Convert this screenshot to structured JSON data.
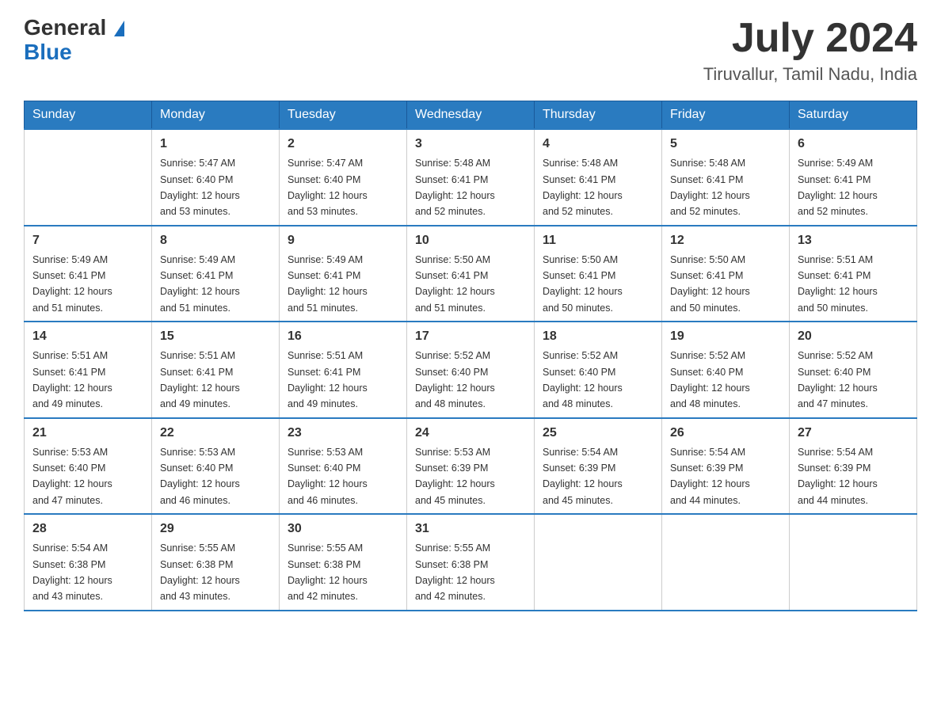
{
  "header": {
    "logo_general": "General",
    "logo_blue": "Blue",
    "month_year": "July 2024",
    "location": "Tiruvallur, Tamil Nadu, India"
  },
  "days_of_week": [
    "Sunday",
    "Monday",
    "Tuesday",
    "Wednesday",
    "Thursday",
    "Friday",
    "Saturday"
  ],
  "weeks": [
    [
      {
        "day": "",
        "info": ""
      },
      {
        "day": "1",
        "info": "Sunrise: 5:47 AM\nSunset: 6:40 PM\nDaylight: 12 hours\nand 53 minutes."
      },
      {
        "day": "2",
        "info": "Sunrise: 5:47 AM\nSunset: 6:40 PM\nDaylight: 12 hours\nand 53 minutes."
      },
      {
        "day": "3",
        "info": "Sunrise: 5:48 AM\nSunset: 6:41 PM\nDaylight: 12 hours\nand 52 minutes."
      },
      {
        "day": "4",
        "info": "Sunrise: 5:48 AM\nSunset: 6:41 PM\nDaylight: 12 hours\nand 52 minutes."
      },
      {
        "day": "5",
        "info": "Sunrise: 5:48 AM\nSunset: 6:41 PM\nDaylight: 12 hours\nand 52 minutes."
      },
      {
        "day": "6",
        "info": "Sunrise: 5:49 AM\nSunset: 6:41 PM\nDaylight: 12 hours\nand 52 minutes."
      }
    ],
    [
      {
        "day": "7",
        "info": "Sunrise: 5:49 AM\nSunset: 6:41 PM\nDaylight: 12 hours\nand 51 minutes."
      },
      {
        "day": "8",
        "info": "Sunrise: 5:49 AM\nSunset: 6:41 PM\nDaylight: 12 hours\nand 51 minutes."
      },
      {
        "day": "9",
        "info": "Sunrise: 5:49 AM\nSunset: 6:41 PM\nDaylight: 12 hours\nand 51 minutes."
      },
      {
        "day": "10",
        "info": "Sunrise: 5:50 AM\nSunset: 6:41 PM\nDaylight: 12 hours\nand 51 minutes."
      },
      {
        "day": "11",
        "info": "Sunrise: 5:50 AM\nSunset: 6:41 PM\nDaylight: 12 hours\nand 50 minutes."
      },
      {
        "day": "12",
        "info": "Sunrise: 5:50 AM\nSunset: 6:41 PM\nDaylight: 12 hours\nand 50 minutes."
      },
      {
        "day": "13",
        "info": "Sunrise: 5:51 AM\nSunset: 6:41 PM\nDaylight: 12 hours\nand 50 minutes."
      }
    ],
    [
      {
        "day": "14",
        "info": "Sunrise: 5:51 AM\nSunset: 6:41 PM\nDaylight: 12 hours\nand 49 minutes."
      },
      {
        "day": "15",
        "info": "Sunrise: 5:51 AM\nSunset: 6:41 PM\nDaylight: 12 hours\nand 49 minutes."
      },
      {
        "day": "16",
        "info": "Sunrise: 5:51 AM\nSunset: 6:41 PM\nDaylight: 12 hours\nand 49 minutes."
      },
      {
        "day": "17",
        "info": "Sunrise: 5:52 AM\nSunset: 6:40 PM\nDaylight: 12 hours\nand 48 minutes."
      },
      {
        "day": "18",
        "info": "Sunrise: 5:52 AM\nSunset: 6:40 PM\nDaylight: 12 hours\nand 48 minutes."
      },
      {
        "day": "19",
        "info": "Sunrise: 5:52 AM\nSunset: 6:40 PM\nDaylight: 12 hours\nand 48 minutes."
      },
      {
        "day": "20",
        "info": "Sunrise: 5:52 AM\nSunset: 6:40 PM\nDaylight: 12 hours\nand 47 minutes."
      }
    ],
    [
      {
        "day": "21",
        "info": "Sunrise: 5:53 AM\nSunset: 6:40 PM\nDaylight: 12 hours\nand 47 minutes."
      },
      {
        "day": "22",
        "info": "Sunrise: 5:53 AM\nSunset: 6:40 PM\nDaylight: 12 hours\nand 46 minutes."
      },
      {
        "day": "23",
        "info": "Sunrise: 5:53 AM\nSunset: 6:40 PM\nDaylight: 12 hours\nand 46 minutes."
      },
      {
        "day": "24",
        "info": "Sunrise: 5:53 AM\nSunset: 6:39 PM\nDaylight: 12 hours\nand 45 minutes."
      },
      {
        "day": "25",
        "info": "Sunrise: 5:54 AM\nSunset: 6:39 PM\nDaylight: 12 hours\nand 45 minutes."
      },
      {
        "day": "26",
        "info": "Sunrise: 5:54 AM\nSunset: 6:39 PM\nDaylight: 12 hours\nand 44 minutes."
      },
      {
        "day": "27",
        "info": "Sunrise: 5:54 AM\nSunset: 6:39 PM\nDaylight: 12 hours\nand 44 minutes."
      }
    ],
    [
      {
        "day": "28",
        "info": "Sunrise: 5:54 AM\nSunset: 6:38 PM\nDaylight: 12 hours\nand 43 minutes."
      },
      {
        "day": "29",
        "info": "Sunrise: 5:55 AM\nSunset: 6:38 PM\nDaylight: 12 hours\nand 43 minutes."
      },
      {
        "day": "30",
        "info": "Sunrise: 5:55 AM\nSunset: 6:38 PM\nDaylight: 12 hours\nand 42 minutes."
      },
      {
        "day": "31",
        "info": "Sunrise: 5:55 AM\nSunset: 6:38 PM\nDaylight: 12 hours\nand 42 minutes."
      },
      {
        "day": "",
        "info": ""
      },
      {
        "day": "",
        "info": ""
      },
      {
        "day": "",
        "info": ""
      }
    ]
  ]
}
